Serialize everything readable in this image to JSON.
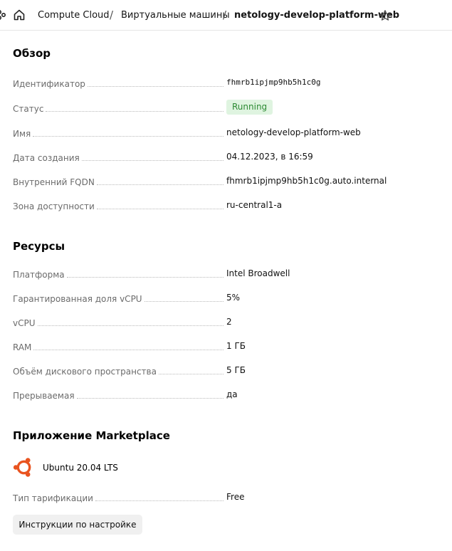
{
  "breadcrumb": {
    "items": [
      "Compute Cloud",
      "Виртуальные машины",
      "netology-develop-platform-web"
    ],
    "separator": "/"
  },
  "overview": {
    "title": "Обзор",
    "rows": [
      {
        "label": "Идентификатор",
        "value": "fhmrb1ipjmp9hb5h1c0g"
      },
      {
        "label": "Статус",
        "value": "Running"
      },
      {
        "label": "Имя",
        "value": "netology-develop-platform-web"
      },
      {
        "label": "Дата создания",
        "value": "04.12.2023, в 16:59"
      },
      {
        "label": "Внутренний FQDN",
        "value": "fhmrb1ipjmp9hb5h1c0g.auto.internal"
      },
      {
        "label": "Зона доступности",
        "value": "ru-central1-a"
      }
    ]
  },
  "resources": {
    "title": "Ресурсы",
    "rows": [
      {
        "label": "Платформа",
        "value": "Intel Broadwell"
      },
      {
        "label": "Гарантированная доля vCPU",
        "value": "5%"
      },
      {
        "label": "vCPU",
        "value": "2"
      },
      {
        "label": "RAM",
        "value": "1 ГБ"
      },
      {
        "label": "Объём дискового пространства",
        "value": "5 ГБ"
      },
      {
        "label": "Прерываемая",
        "value": "да"
      }
    ]
  },
  "marketplace": {
    "title": "Приложение Marketplace",
    "app_name": "Ubuntu 20.04 LTS",
    "app_icon": "ubuntu-icon",
    "billing_label": "Тип тарификации",
    "billing_value": "Free",
    "instructions_button": "Инструкции по настройке"
  },
  "colors": {
    "status_bg": "#dff4e0",
    "status_text": "#2c8a33",
    "ubuntu_orange": "#e95420"
  }
}
